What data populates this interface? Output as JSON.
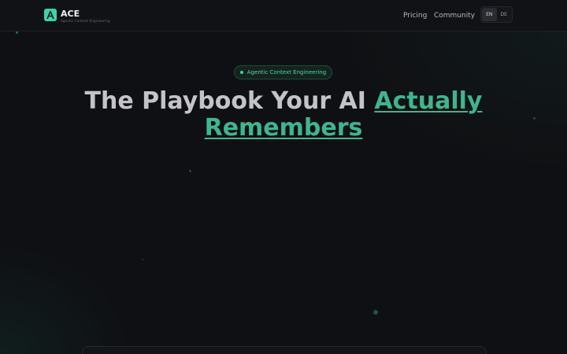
{
  "header": {
    "brand_name": "ACE",
    "brand_tagline": "Agentic Context Engineering",
    "nav": [
      {
        "label": "Pricing"
      },
      {
        "label": "Community"
      }
    ],
    "languages": [
      {
        "code": "EN",
        "active": true
      },
      {
        "code": "DE",
        "active": false
      }
    ]
  },
  "hero": {
    "badge": "Agentic Context Engineering",
    "title_plain": "The Playbook Your AI ",
    "title_accent": "Actually Remembers"
  },
  "colors": {
    "accent": "#3dd4a4",
    "accent_text": "#3fb58e",
    "background": "#0f1013"
  },
  "icons": {
    "logo": "ace-logo-icon",
    "badge_dot": "status-dot-icon"
  }
}
